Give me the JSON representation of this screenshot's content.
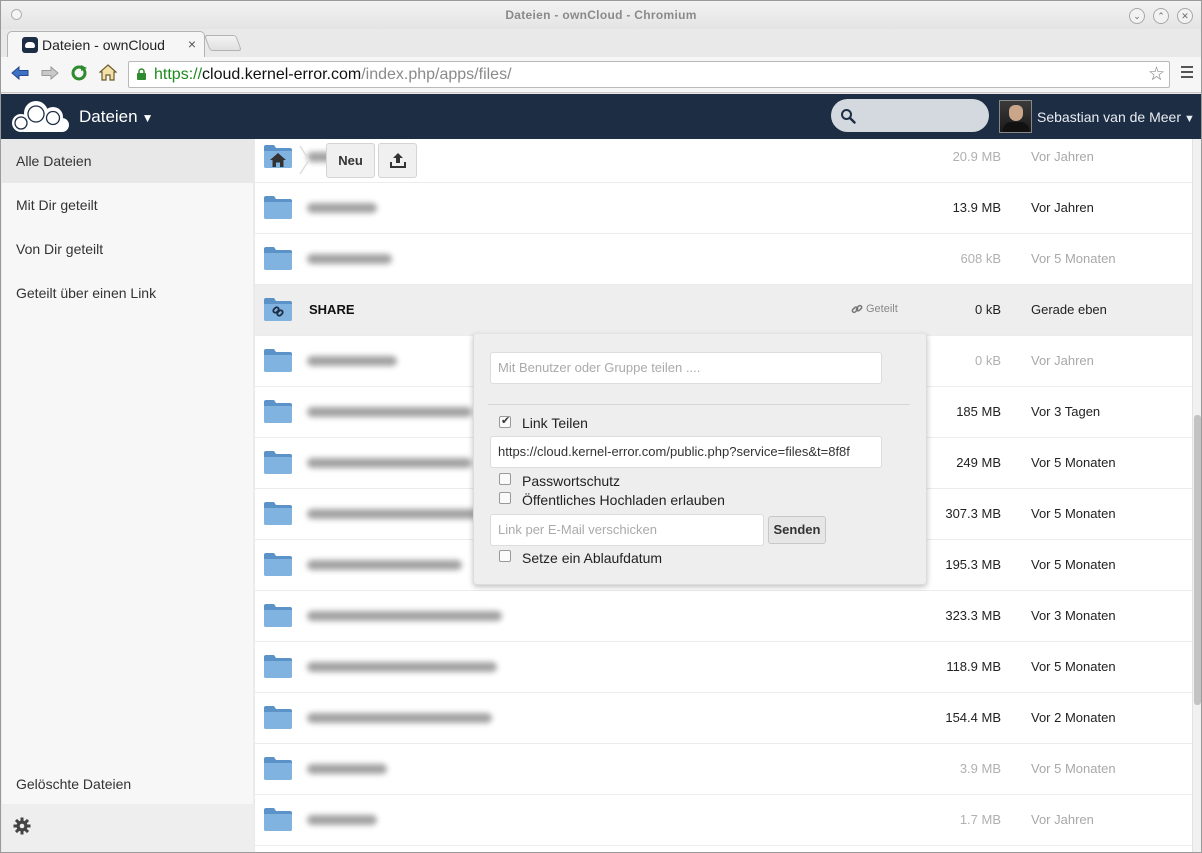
{
  "window": {
    "title": "Dateien - ownCloud - Chromium"
  },
  "tab": {
    "label": "Dateien - ownCloud",
    "close": "×"
  },
  "address_bar": {
    "scheme": "https://",
    "host": "cloud.kernel-error.com",
    "path": "/index.php/apps/files/"
  },
  "header": {
    "app_title": "Dateien",
    "search_placeholder": "",
    "user_name": "Sebastian van de Meer"
  },
  "sidebar": {
    "items": [
      {
        "label": "Alle Dateien",
        "active": true
      },
      {
        "label": "Mit Dir geteilt"
      },
      {
        "label": "Von Dir geteilt"
      },
      {
        "label": "Geteilt über einen Link"
      }
    ],
    "deleted": "Gelöschte Dateien"
  },
  "controls": {
    "new_label": "Neu"
  },
  "files": [
    {
      "name": "",
      "size": "20.9 MB",
      "modified": "Vor Jahren",
      "blurred": true,
      "faint": true
    },
    {
      "name": "",
      "size": "13.9 MB",
      "modified": "Vor Jahren",
      "blurred": true
    },
    {
      "name": "",
      "size": "608 kB",
      "modified": "Vor 5 Monaten",
      "blurred": true,
      "faint": true
    },
    {
      "name": "SHARE",
      "size": "0 kB",
      "modified": "Gerade eben",
      "shared_label": "Geteilt",
      "selected": true
    },
    {
      "name": "",
      "size": "0 kB",
      "modified": "Vor Jahren",
      "blurred": true,
      "faint": true
    },
    {
      "name": "",
      "size": "185 MB",
      "modified": "Vor 3 Tagen",
      "blurred": true
    },
    {
      "name": "",
      "size": "249 MB",
      "modified": "Vor 5 Monaten",
      "blurred": true
    },
    {
      "name": "",
      "size": "307.3 MB",
      "modified": "Vor 5 Monaten",
      "blurred": true
    },
    {
      "name": "",
      "size": "195.3 MB",
      "modified": "Vor 5 Monaten",
      "blurred": true
    },
    {
      "name": "",
      "size": "323.3 MB",
      "modified": "Vor 3 Monaten",
      "blurred": true
    },
    {
      "name": "",
      "size": "118.9 MB",
      "modified": "Vor 5 Monaten",
      "blurred": true
    },
    {
      "name": "",
      "size": "154.4 MB",
      "modified": "Vor 2 Monaten",
      "blurred": true
    },
    {
      "name": "",
      "size": "3.9 MB",
      "modified": "Vor 5 Monaten",
      "blurred": true,
      "faint": true
    },
    {
      "name": "",
      "size": "1.7 MB",
      "modified": "Vor Jahren",
      "blurred": true,
      "faint": true
    }
  ],
  "share_dropdown": {
    "user_group_placeholder": "Mit Benutzer oder Gruppe teilen ....",
    "link_share_label": "Link Teilen",
    "link_share_checked": true,
    "link_url": "https://cloud.kernel-error.com/public.php?service=files&t=8f8f",
    "password_label": "Passwortschutz",
    "public_upload_label": "Öffentliches Hochladen erlauben",
    "email_placeholder": "Link per E-Mail verschicken",
    "send_label": "Senden",
    "expiry_label": "Setze ein Ablaufdatum"
  }
}
